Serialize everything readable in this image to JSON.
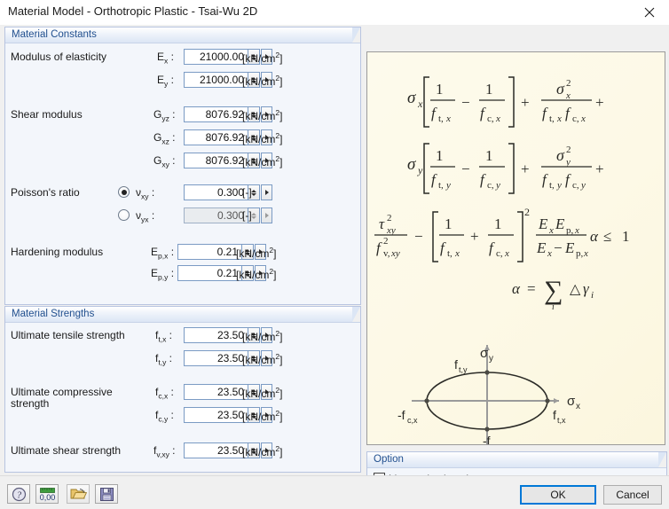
{
  "window": {
    "title": "Material Model - Orthotropic Plastic - Tsai-Wu 2D",
    "close_icon": "close-icon"
  },
  "groups": {
    "material_constants": {
      "title": "Material Constants"
    },
    "material_strengths": {
      "title": "Material Strengths"
    },
    "option": {
      "title": "Option"
    }
  },
  "fields": {
    "modulus_of_elasticity": {
      "label": "Modulus of elasticity",
      "rows": [
        {
          "symbol": "E",
          "sub": "x",
          "colon": ":",
          "value": "21000.00",
          "unit": "kN/cm",
          "unit_sup": "2"
        },
        {
          "symbol": "E",
          "sub": "y",
          "colon": ":",
          "value": "21000.00",
          "unit": "kN/cm",
          "unit_sup": "2"
        }
      ]
    },
    "shear_modulus": {
      "label": "Shear modulus",
      "rows": [
        {
          "symbol": "G",
          "sub": "yz",
          "colon": ":",
          "value": "8076.92",
          "unit": "kN/cm",
          "unit_sup": "2"
        },
        {
          "symbol": "G",
          "sub": "xz",
          "colon": ":",
          "value": "8076.92",
          "unit": "kN/cm",
          "unit_sup": "2"
        },
        {
          "symbol": "G",
          "sub": "xy",
          "colon": ":",
          "value": "8076.92",
          "unit": "kN/cm",
          "unit_sup": "2"
        }
      ]
    },
    "poissons_ratio": {
      "label": "Poisson's ratio",
      "rows": [
        {
          "symbol": "ν",
          "sub": "xy",
          "colon": ":",
          "value": "0.300",
          "unit": "[-]",
          "selected": true,
          "disabled": false
        },
        {
          "symbol": "ν",
          "sub": "yx",
          "colon": ":",
          "value": "0.300",
          "unit": "[-]",
          "selected": false,
          "disabled": true
        }
      ]
    },
    "hardening_modulus": {
      "label": "Hardening modulus",
      "rows": [
        {
          "symbol": "E",
          "sub": "p,x",
          "colon": ":",
          "value": "0.21",
          "unit": "kN/cm",
          "unit_sup": "2"
        },
        {
          "symbol": "E",
          "sub": "p,y",
          "colon": ":",
          "value": "0.21",
          "unit": "kN/cm",
          "unit_sup": "2"
        }
      ]
    },
    "ultimate_tensile_strength": {
      "label": "Ultimate tensile strength",
      "rows": [
        {
          "symbol": "f",
          "sub": "t,x",
          "colon": ":",
          "value": "23.50",
          "unit": "kN/cm",
          "unit_sup": "2"
        },
        {
          "symbol": "f",
          "sub": "t,y",
          "colon": ":",
          "value": "23.50",
          "unit": "kN/cm",
          "unit_sup": "2"
        }
      ]
    },
    "ultimate_compressive_strength": {
      "label": "Ultimate compressive strength",
      "label_line1": "Ultimate compressive",
      "label_line2": "strength",
      "rows": [
        {
          "symbol": "f",
          "sub": "c,x",
          "colon": ":",
          "value": "23.50",
          "unit": "kN/cm",
          "unit_sup": "2"
        },
        {
          "symbol": "f",
          "sub": "c,y",
          "colon": ":",
          "value": "23.50",
          "unit": "kN/cm",
          "unit_sup": "2"
        }
      ]
    },
    "ultimate_shear_strength": {
      "label": "Ultimate shear strength",
      "rows": [
        {
          "symbol": "f",
          "sub": "v,xy",
          "colon": ":",
          "value": "23.50",
          "unit": "kN/cm",
          "unit_sup": "2"
        }
      ]
    }
  },
  "option": {
    "linear_elastic_only": {
      "label": "Linear elastic only",
      "checked": false
    }
  },
  "formula_panel": {
    "background_color": "#fdf9e6",
    "equations": [
      "σx [ 1/ft,x - 1/fc,x ] + σx²/(ft,x fc,x) +",
      "σy [ 1/ft,y - 1/fc,y ] + σy²/(ft,y fc,y) +",
      "τxy²/fv,xy² - [ 1/ft,x + 1/fc,x ]² (Ex Ep,x)/(Ex - Ep,x) α ≤ 1",
      "α = ∑i Δγi"
    ],
    "diagram": {
      "name": "tsai-wu-ellipse-diagram",
      "axis_x_label": "σ",
      "axis_x_sub": "x",
      "axis_y_label": "σ",
      "axis_y_sub": "y",
      "point_top": "f",
      "point_top_sub": "t,y",
      "point_right": "f",
      "point_right_sub": "t,x",
      "point_left": "-f",
      "point_left_sub": "c,x",
      "point_bottom": "-f",
      "point_bottom_sub": "c,y"
    }
  },
  "footer": {
    "toolbar": [
      {
        "name": "help-icon",
        "title": "Help"
      },
      {
        "name": "units-icon",
        "title": "Units and decimal places",
        "text": "0.00"
      },
      {
        "name": "open-folder-icon",
        "title": "Import"
      },
      {
        "name": "save-icon",
        "title": "Save"
      }
    ],
    "ok_label": "OK",
    "cancel_label": "Cancel"
  }
}
